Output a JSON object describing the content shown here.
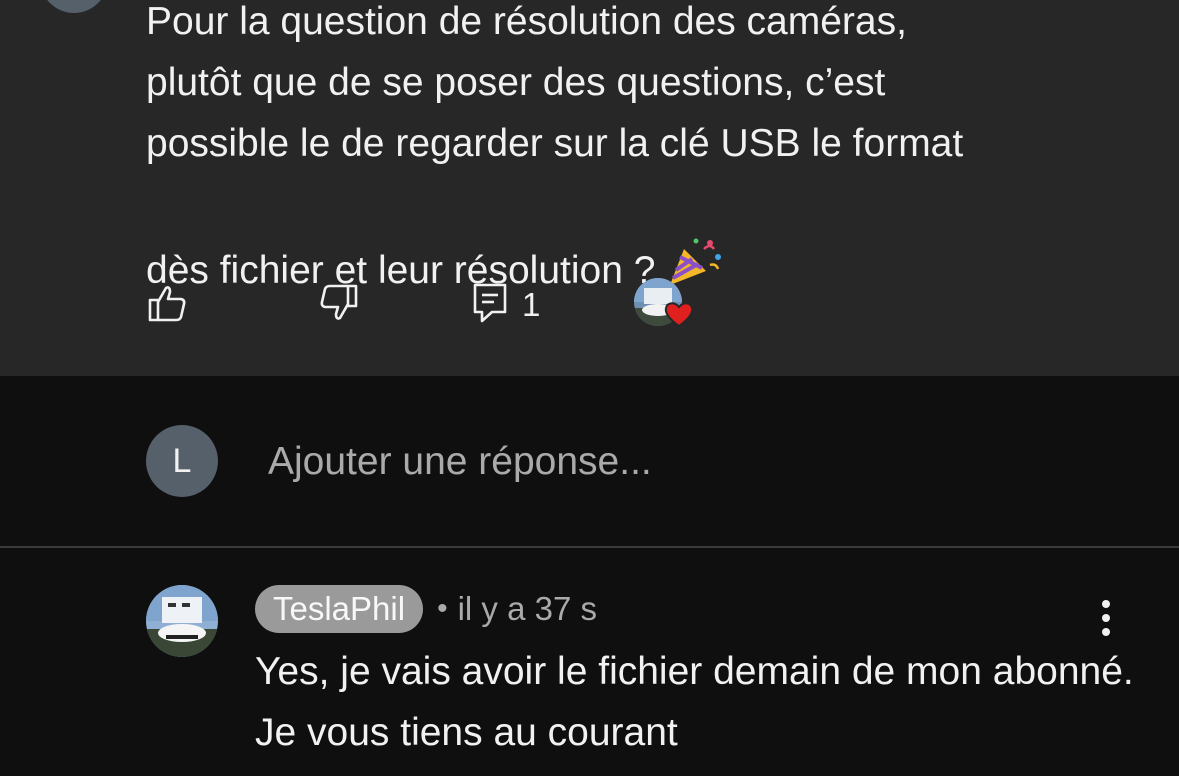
{
  "comment": {
    "text_lines": [
      "Pour la question de résolution des caméras,",
      "plutôt que de se poser des questions, c’est",
      "possible le de regarder sur la clé USB le format",
      "dès fichier et leur résolution ?"
    ],
    "emoji_icon": "party-popper-icon",
    "reply_count": "1"
  },
  "add_reply": {
    "avatar_letter": "L",
    "placeholder": "Ajouter une réponse..."
  },
  "reply": {
    "author": "TeslaPhil",
    "separator": "•",
    "time": "il y a 37 s",
    "text": "Yes, je vais avoir le fichier demain de mon abonné. Je vous tiens au courant"
  },
  "colors": {
    "card_bg": "#272727",
    "page_bg": "#0f0f0f",
    "text": "#f1f1f1",
    "muted": "#aaaaaa",
    "heart": "#e0201e",
    "author_chip": "#9a9a9a"
  }
}
